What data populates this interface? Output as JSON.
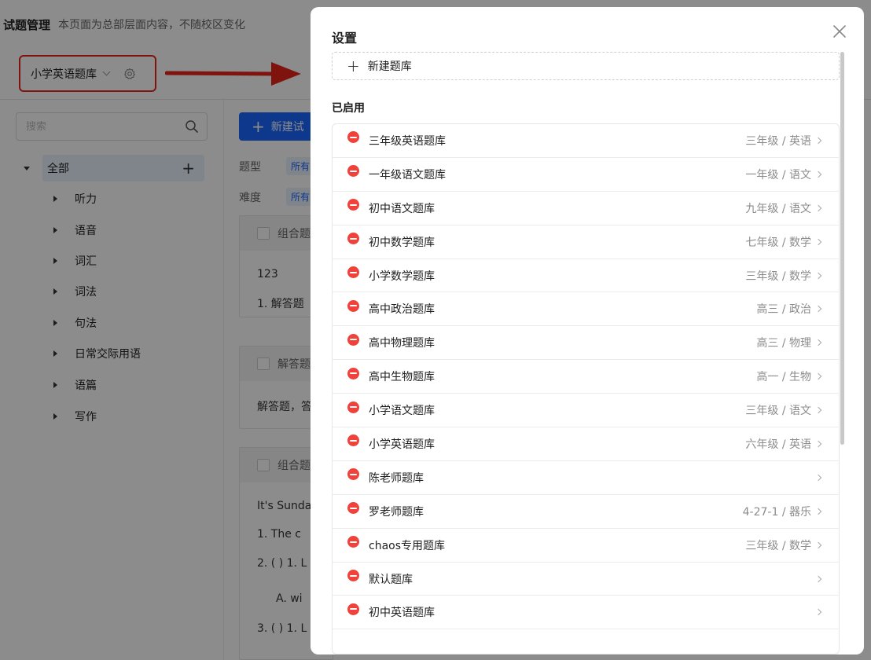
{
  "page": {
    "title": "试题管理",
    "subtitle": "本页面为总部层面内容，不随校区变化",
    "bank_select": "小学英语题库"
  },
  "sidebar": {
    "search_placeholder": "搜索",
    "root": "全部",
    "items": [
      "听力",
      "语音",
      "词汇",
      "词法",
      "句法",
      "日常交际用语",
      "语篇",
      "写作"
    ]
  },
  "main": {
    "new_button": "新建试",
    "filter_type_label": "题型",
    "filter_diff_label": "难度",
    "filter_tag": "所有",
    "cards": [
      {
        "head": "组合题",
        "lines": [
          "123",
          "1.   解答题"
        ]
      },
      {
        "head": "解答题",
        "lines": [
          "解答题，答"
        ]
      },
      {
        "head": "组合题",
        "lines": [
          "It's Sunda",
          "1.    The c",
          "2.    ( ) 1. L",
          "A.   wi",
          "3.    ( ) 1. L"
        ]
      }
    ]
  },
  "modal": {
    "title": "设置",
    "new_bank_label": "新建题库",
    "section_enabled": "已启用",
    "banks": [
      {
        "name": "三年级英语题库",
        "tag": "三年级 / 英语"
      },
      {
        "name": "一年级语文题库",
        "tag": "一年级 / 语文"
      },
      {
        "name": "初中语文题库",
        "tag": "九年级 / 语文"
      },
      {
        "name": "初中数学题库",
        "tag": "七年级 / 数学"
      },
      {
        "name": "小学数学题库",
        "tag": "三年级 / 数学"
      },
      {
        "name": "高中政治题库",
        "tag": "高三 / 政治"
      },
      {
        "name": "高中物理题库",
        "tag": "高三 / 物理"
      },
      {
        "name": "高中生物题库",
        "tag": "高一 / 生物"
      },
      {
        "name": "小学语文题库",
        "tag": "三年级 / 语文"
      },
      {
        "name": "小学英语题库",
        "tag": "六年级 / 英语"
      },
      {
        "name": "陈老师题库",
        "tag": ""
      },
      {
        "name": "罗老师题库",
        "tag": "4-27-1 / 器乐"
      },
      {
        "name": "chaos专用题库",
        "tag": "三年级 / 数学"
      },
      {
        "name": "默认题库",
        "tag": ""
      },
      {
        "name": "初中英语题库",
        "tag": ""
      }
    ]
  },
  "colors": {
    "accent": "#1a66ff",
    "danger": "#f0423a",
    "highlight_box": "#e8241a"
  }
}
